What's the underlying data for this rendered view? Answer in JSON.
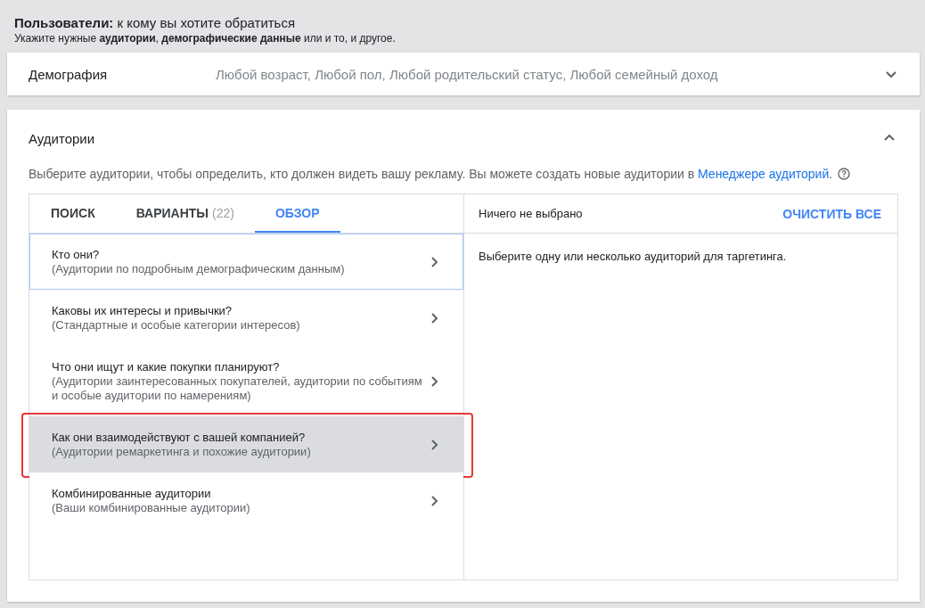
{
  "header": {
    "title": "**Пользователи:** к кому вы хотите обратиться",
    "subtitle": "Укажите нужные **аудитории**, **демографические данные** или и то, и другое."
  },
  "demographics": {
    "label": "Демография",
    "summary": "Любой возраст, Любой пол, Любой родительский статус, Любой семейный доход",
    "expanded": false
  },
  "audiences": {
    "title": "Аудитории",
    "expanded": true,
    "description": "Выберите аудитории, чтобы определить, кто должен видеть вашу рекламу. Вы можете создать новые аудитории в",
    "link": "Менеджере аудиторий",
    "after_link": ".",
    "tabs": [
      {
        "label": "ПОИСК",
        "selected": false
      },
      {
        "label": "ВАРИАНТЫ",
        "count": "(22)",
        "selected": false
      },
      {
        "label": "ОБЗОР",
        "selected": true
      }
    ],
    "categories": [
      {
        "title": "Кто они?",
        "subtitle": "(Аудитории по подробным демографическим данным)",
        "focused": true,
        "selected": false,
        "annotated": false
      },
      {
        "title": "Каковы их интересы и привычки?",
        "subtitle": "(Стандартные и особые категории интересов)",
        "focused": false,
        "selected": false,
        "annotated": false
      },
      {
        "title": "Что они ищут и какие покупки планируют?",
        "subtitle": "(Аудитории заинтересованных покупателей, аудитории по событиям и особые аудитории по намерениям)",
        "focused": false,
        "selected": false,
        "annotated": false
      },
      {
        "title": "Как они взаимодействуют с вашей компанией?",
        "subtitle": "(Аудитории ремаркетинга и похожие аудитории)",
        "focused": false,
        "selected": true,
        "annotated": true
      },
      {
        "title": "Комбинированные аудитории",
        "subtitle": "(Ваши комбинированные аудитории)",
        "focused": false,
        "selected": false,
        "annotated": false
      }
    ],
    "selection": {
      "status": "Ничего не выбрано",
      "clear_button": "ОЧИСТИТЬ ВСЕ",
      "hint": "Выберите одну или несколько аудиторий для таргетинга."
    }
  }
}
